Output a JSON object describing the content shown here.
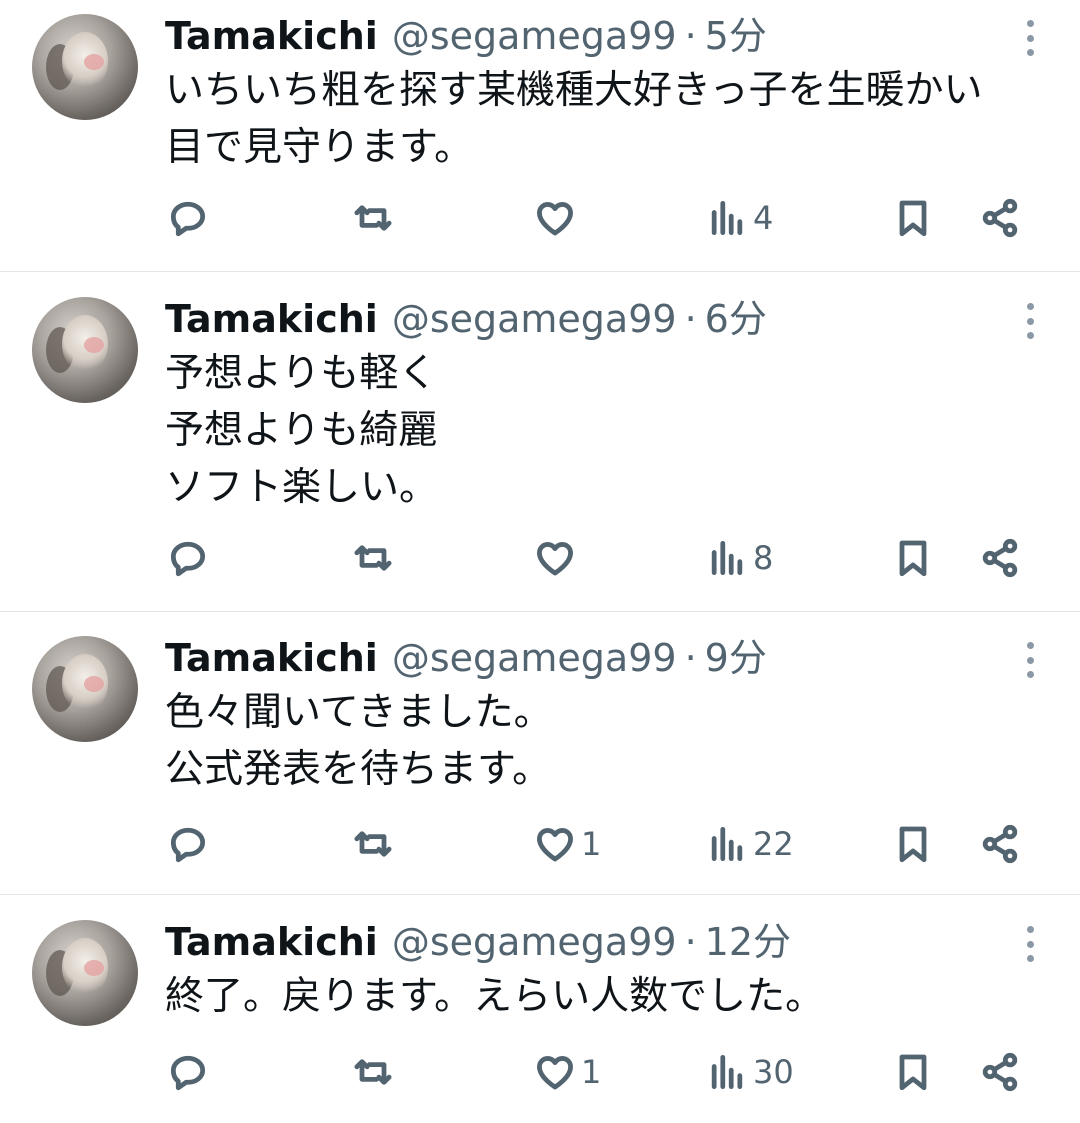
{
  "tweets": [
    {
      "name": "Tamakichi",
      "handle": "@segamega99",
      "separator": "·",
      "time": "5分",
      "text": "いちいち粗を探す某機種大好きっ子を生暖かい\n目で見守ります。",
      "likes": "",
      "views": "4"
    },
    {
      "name": "Tamakichi",
      "handle": "@segamega99",
      "separator": "·",
      "time": "6分",
      "text": "予想よりも軽く\n予想よりも綺麗\nソフト楽しい。",
      "likes": "",
      "views": "8"
    },
    {
      "name": "Tamakichi",
      "handle": "@segamega99",
      "separator": "·",
      "time": "9分",
      "text": "色々聞いてきました。\n公式発表を待ちます。",
      "likes": "1",
      "views": "22"
    },
    {
      "name": "Tamakichi",
      "handle": "@segamega99",
      "separator": "·",
      "time": "12分",
      "text": "終了。戻ります。えらい人数でした。",
      "likes": "1",
      "views": "30"
    }
  ],
  "icons": {
    "reply": "reply-icon",
    "retweet": "retweet-icon",
    "like": "heart-icon",
    "views": "views-icon",
    "bookmark": "bookmark-icon",
    "share": "share-icon",
    "more": "more-icon"
  },
  "colors": {
    "text": "#0f1419",
    "secondary": "#536471",
    "divider": "#e1e6ea"
  }
}
